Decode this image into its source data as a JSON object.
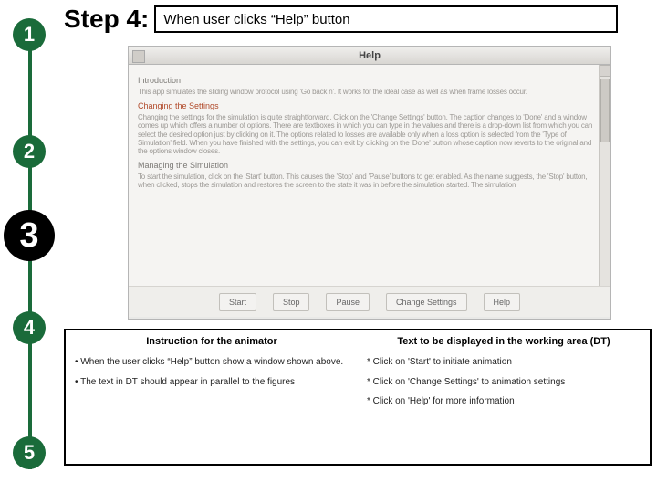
{
  "timeline": {
    "s1": "1",
    "s2": "2",
    "s3": "3",
    "s4": "4",
    "s5": "5"
  },
  "header": {
    "step_label": "Step 4:",
    "title": "When user clicks “Help” button"
  },
  "screenshot": {
    "titlebar": "Help",
    "h1": "Introduction",
    "p1": "This app simulates the sliding window protocol using 'Go back n'. It works for the ideal case as well as when frame losses occur.",
    "h2": "Changing the Settings",
    "p2": "Changing the settings for the simulation is quite straightforward. Click on the 'Change Settings' button. The caption changes to 'Done' and a window comes up which offers a number of options. There are textboxes in which you can type in the values and there is a drop-down list from which you can select the desired option just by clicking on it. The options related to losses are available only when a loss option is selected from the 'Type of Simulation' field. When you have finished with the settings, you can exit by clicking on the 'Done' button whose caption now reverts to the original and the options window closes.",
    "h3": "Managing the Simulation",
    "p3": "To start the simulation, click on the 'Start' button. This causes the 'Stop' and 'Pause' buttons to get enabled. As the name suggests, the 'Stop' button, when clicked, stops the simulation and restores the screen to the state it was in before the simulation started. The simulation",
    "buttons": {
      "start": "Start",
      "stop": "Stop",
      "pause": "Pause",
      "change": "Change Settings",
      "help": "Help"
    }
  },
  "bottom": {
    "left_h": "Instruction for the animator",
    "left_items": [
      "When the user clicks “Help” button show a window shown above.",
      "The text in DT should appear in parallel to the figures"
    ],
    "right_h": "Text to be displayed in the working area (DT)",
    "right_items": [
      "Click on 'Start' to initiate animation",
      "Click on 'Change Settings' to animation settings",
      "Click on 'Help' for more information"
    ]
  }
}
